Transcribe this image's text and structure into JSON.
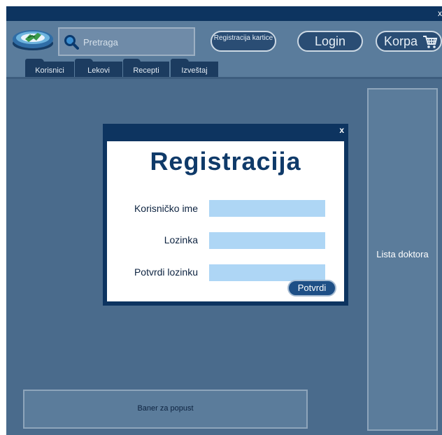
{
  "window": {
    "close_label": "x"
  },
  "header": {
    "search_placeholder": "Pretraga",
    "register_card_label": "Registracija kartice",
    "login_label": "Login",
    "cart_label": "Korpa"
  },
  "tabs": [
    {
      "label": "Korisnici"
    },
    {
      "label": "Lekovi"
    },
    {
      "label": "Recepti"
    },
    {
      "label": "Izveštaj"
    }
  ],
  "sidebar": {
    "doctors_label": "Lista doktora"
  },
  "banner": {
    "label": "Baner za popust"
  },
  "modal": {
    "close_label": "x",
    "title": "Registracija",
    "fields": [
      {
        "label": "Korisničko ime",
        "value": ""
      },
      {
        "label": "Lozinka",
        "value": ""
      },
      {
        "label": "Potvrdi lozinku",
        "value": ""
      }
    ],
    "submit_label": "Potvrdi"
  },
  "colors": {
    "dark_navy": "#0d3460",
    "background": "#4a6b8c",
    "field_fill": "#aed6f5",
    "title_blue": "#0f3a69"
  },
  "icons": [
    "logo-icon",
    "search-icon",
    "cart-icon"
  ]
}
